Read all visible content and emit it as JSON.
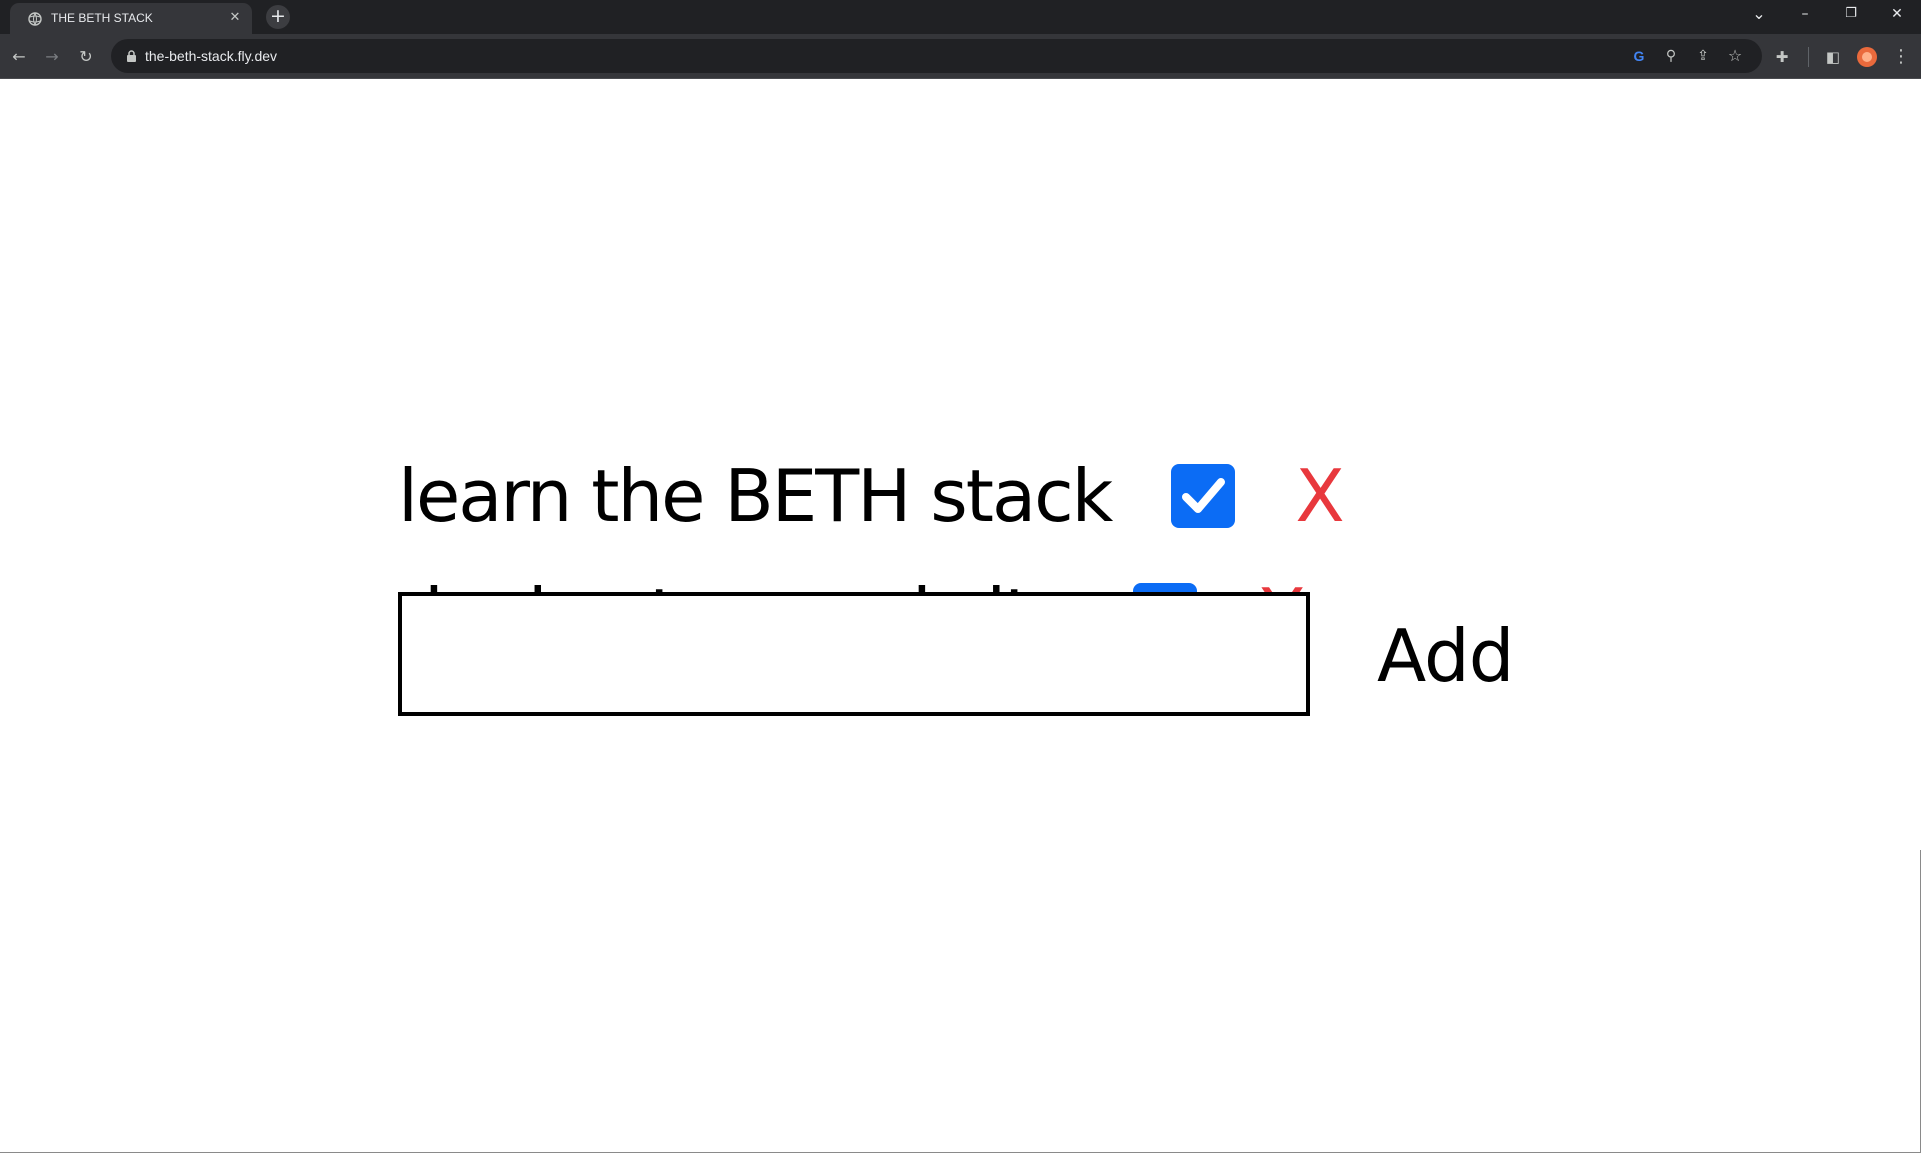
{
  "browser": {
    "tab": {
      "title": "THE BETH STACK",
      "close_glyph": "✕",
      "favicon": "globe-icon"
    },
    "new_tab_glyph": "+",
    "window_controls": {
      "tab_search_glyph": "⌄",
      "minimize_glyph": "–",
      "restore_glyph": "❐",
      "close_glyph": "✕"
    },
    "nav": {
      "back_glyph": "←",
      "forward_glyph": "→",
      "reload_glyph": "↻"
    },
    "address_bar": {
      "url": "the-beth-stack.fly.dev",
      "lock_icon": "lock-icon"
    },
    "omnibox_icons": {
      "google_glyph": "G",
      "zoom_glyph": "⚲",
      "share_glyph": "⇪",
      "bookmark_glyph": "☆"
    },
    "toolbar_icons": {
      "extensions_glyph": "✚",
      "side_panel_glyph": "◧",
      "menu_glyph": "⋮"
    },
    "colors": {
      "titlebar": "#202124",
      "toolbar": "#35363a"
    }
  },
  "todos": [
    {
      "text": "learn the BETH stack",
      "completed": true,
      "delete_label": "X"
    },
    {
      "text": "deploy to a real site",
      "completed": true,
      "delete_label": "X"
    }
  ],
  "add_form": {
    "input_value": "",
    "button_label": "Add"
  },
  "colors": {
    "checkbox": "#0b6cf5",
    "delete": "#e8383d"
  }
}
